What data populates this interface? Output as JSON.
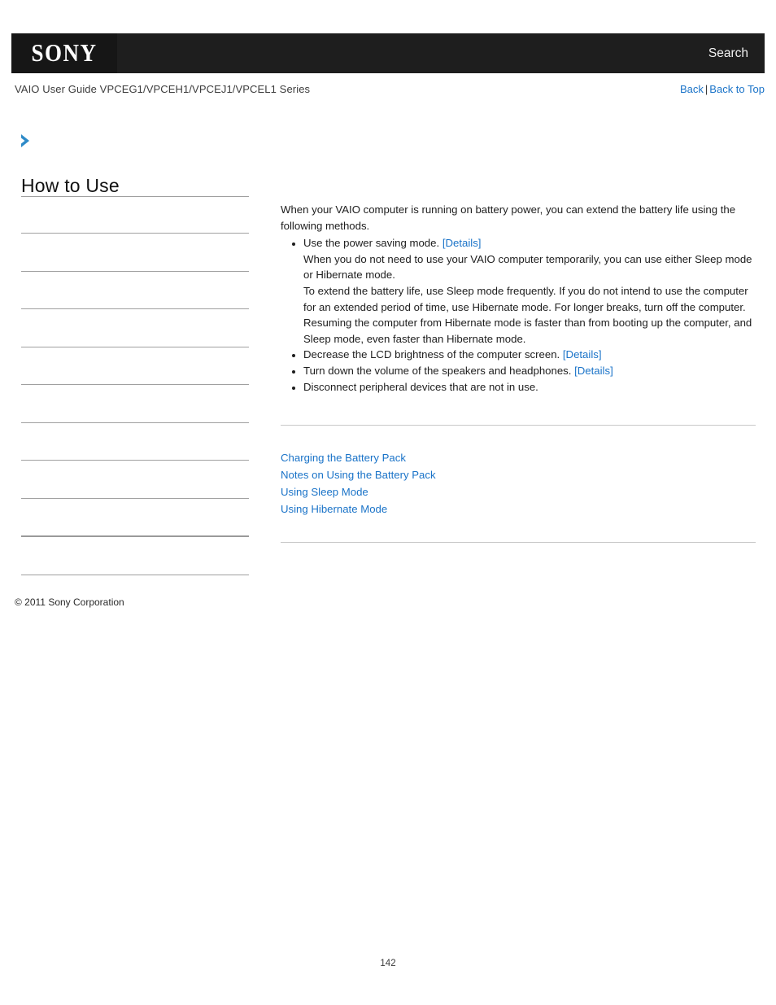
{
  "header": {
    "logo_text": "SONY",
    "search_label": "Search",
    "guide_title": "VAIO User Guide VPCEG1/VPCEH1/VPCEJ1/VPCEL1 Series",
    "back_label": "Back",
    "separator": "|",
    "back_to_top_label": "Back to Top"
  },
  "sidebar": {
    "expand_icon": "chevron-right-icon",
    "title": "How to Use",
    "items": [
      {
        "label": ""
      },
      {
        "label": ""
      },
      {
        "label": ""
      },
      {
        "label": ""
      },
      {
        "label": ""
      },
      {
        "label": ""
      },
      {
        "label": ""
      },
      {
        "label": ""
      },
      {
        "label": ""
      },
      {
        "label": ""
      }
    ],
    "copyright": "© 2011 Sony Corporation"
  },
  "main": {
    "intro": "When your VAIO computer is running on battery power, you can extend the battery life using the following methods.",
    "bullets": [
      {
        "text": "Use the power saving mode.",
        "link": "[Details]",
        "sublines": [
          "When you do not need to use your VAIO computer temporarily, you can use either Sleep mode or Hibernate mode.",
          "To extend the battery life, use Sleep mode frequently. If you do not intend to use the computer for an extended period of time, use Hibernate mode. For longer breaks, turn off the computer.",
          "Resuming the computer from Hibernate mode is faster than from booting up the computer, and Sleep mode, even faster than Hibernate mode."
        ]
      },
      {
        "text": "Decrease the LCD brightness of the computer screen.",
        "link": "[Details]",
        "sublines": []
      },
      {
        "text": "Turn down the volume of the speakers and headphones.",
        "link": "[Details]",
        "sublines": []
      },
      {
        "text": "Disconnect peripheral devices that are not in use.",
        "link": "",
        "sublines": []
      }
    ],
    "related_links": [
      "Charging the Battery Pack",
      "Notes on Using the Battery Pack",
      "Using Sleep Mode",
      "Using Hibernate Mode"
    ]
  },
  "footer": {
    "page_number": "142"
  },
  "colors": {
    "link": "#1a73c8",
    "topbar": "#1e1e1e",
    "rule": "#c8c8c8"
  }
}
